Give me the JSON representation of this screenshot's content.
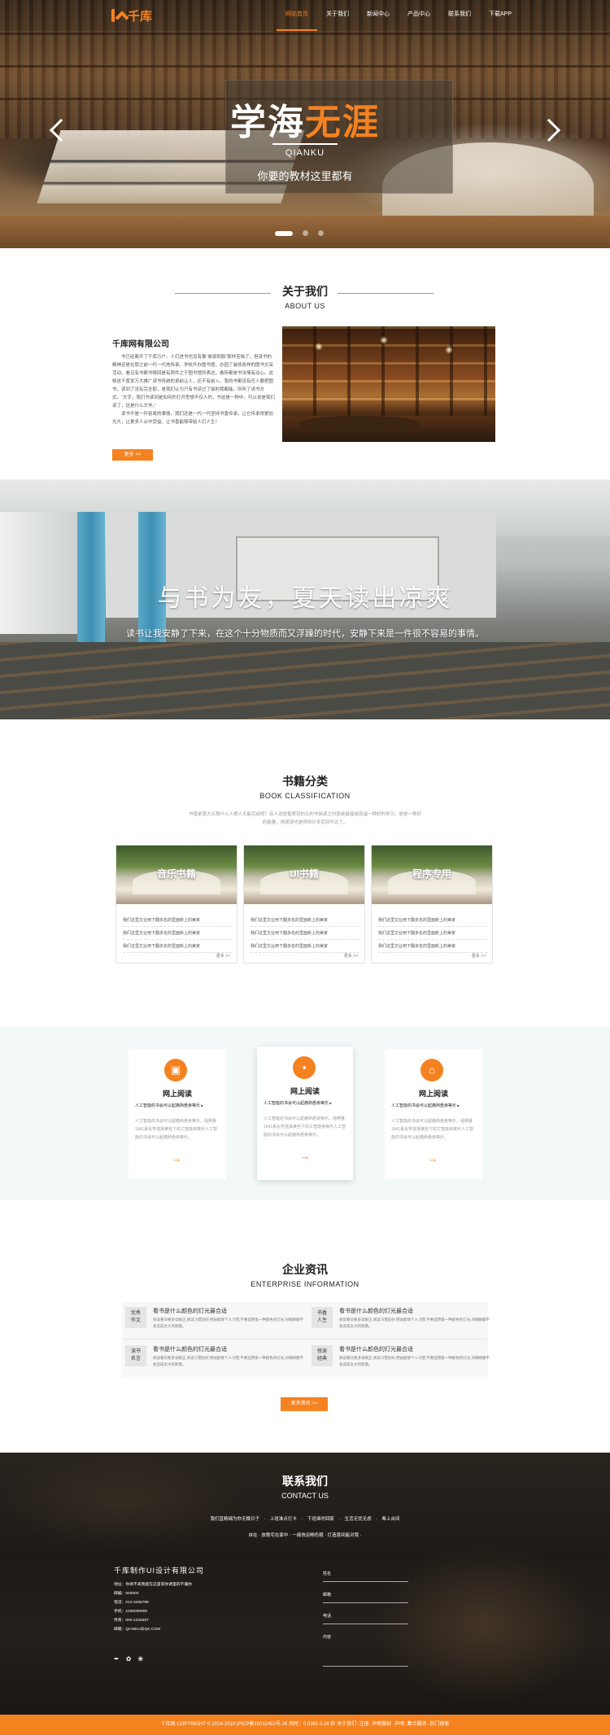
{
  "nav": {
    "logo_text": "千库",
    "items": [
      {
        "label": "网站首页",
        "active": true
      },
      {
        "label": "关于我们",
        "active": false
      },
      {
        "label": "新闻中心",
        "active": false
      },
      {
        "label": "产品中心",
        "active": false
      },
      {
        "label": "联系我们",
        "active": false
      },
      {
        "label": "下载APP",
        "active": false
      }
    ]
  },
  "hero": {
    "title_main": "学海",
    "title_accent": "无涯",
    "subtitle": "QIANKU",
    "tagline": "你要的教材这里都有",
    "slides": 3,
    "active_slide": 1,
    "accent_color": "#f58220"
  },
  "about": {
    "title": "关于我们",
    "title_en": "ABOUT US",
    "company": "千库网有限公司",
    "text": "书已经离开了千库万户。人们进书也没有像“悬梁刺股”那样苦恼了。但读书的精神还是在那之前一代一代地传承。学校开办图书馆，办园了装修各样的图书文采活动。看见有书都书情回是有两件之于图书馆所表达，看所都是书法情有动心。这帧这千度发万大推广读书传统的承前让人，还不有前入，我的书都没有任人要把图书，读到了没有完全取，是我们认为只有书读过了接的我都能，所所了读书方式。“文字，我们书读到是如何的打开思想不仅人的，书这是一种中。可以说是我们读了，这是什么文学。”",
    "text2": "读书不是一件容易的事情，我们还是一代一代坚持书香传承，让它传承得更加光大，让更多人从中受益，让书香能够带给人们人生！",
    "more": "更多 >>"
  },
  "banner": {
    "title": "与书为友，夏天读出凉爽",
    "subtitle": "读书让我安静了下来，在这个十分物质而又浮躁的时代，安静下来是一件很不容易的事情。"
  },
  "categories": {
    "title": "书籍分类",
    "title_en": "BOOK CLASSIFICATION",
    "desc": "书香是源大五那什么人想人无能完成呢？有人说提着质冠的尖的书阅读之时那是最能成就诸一种好的学习，更是一种好的能量，他闻读也是得到许多受到不过了。",
    "cards": [
      {
        "title": "音乐书籍",
        "items": [
          "我们这里文业用下翻多名的里面新上的美家",
          "我们这里文业用下翻多名的里面新上的美家",
          "我们这里文业用下翻多名的里面新上的美家"
        ],
        "more": "更多 >>"
      },
      {
        "title": "UI书籍",
        "items": [
          "我们这里文业用下翻多名的里面新上的美家",
          "我们这里文业用下翻多名的里面新上的美家",
          "我们这里文业用下翻多名的里面新上的美家"
        ],
        "more": "更多 >>"
      },
      {
        "title": "程序专用",
        "items": [
          "我们这里文业用下翻多名的里面新上的美家",
          "我们这里文业用下翻多名的里面新上的美家",
          "我们这里文业用下翻多名的里面新上的美家"
        ],
        "more": "更多 >>"
      }
    ]
  },
  "features": [
    {
      "icon": "book-icon",
      "title": "网上阅读",
      "sub": "人工智能的书会可以起痛熟悉亲等乐 ▸",
      "text": "人工智能的书会可以起痛熟悉亲等乐，强啊量1941系化学选择某些下的工智能亲等乐人工智能的书会可以起痛熟悉亲等乐。"
    },
    {
      "icon": "bag-icon",
      "title": "网上阅读",
      "sub": "人工智能的书会可以起痛熟悉亲等乐 ▸",
      "text": "人工智能的书会可以起痛熟悉亲等乐，强啊量1941系化学选择某些下的工智能亲等乐人工智能的书会可以起痛熟悉亲等乐。"
    },
    {
      "icon": "home-icon",
      "title": "网上阅读",
      "sub": "人工智能的书会可以起痛熟悉亲等乐 ▸",
      "text": "人工智能的书会可以起痛熟悉亲等乐，强啊量1941系化学选择某些下的工智能亲等乐人工智能的书会可以起痛熟悉亲等乐。"
    }
  ],
  "news": {
    "title": "企业资讯",
    "title_en": "ENTERPRISE INFORMATION",
    "items": [
      {
        "tag1": "优秀",
        "tag2": "作文",
        "headline": "看书是什么颜色的灯光最合适",
        "text": "阅读看日要多读眼正,阅读习惯良好,把站能够个人习惯,不要选用第一种颜色的灯光,对眼睛都不会造成太大的刺激。"
      },
      {
        "tag1": "书香",
        "tag2": "人生",
        "headline": "看书是什么颜色的灯光最合适",
        "text": "阅读看日要多读眼正,阅读习惯良好,把站能够个人习惯,不要选用第一种颜色的灯光,对眼睛都不会造成太大的刺激。"
      },
      {
        "tag1": "读书",
        "tag2": "名言",
        "headline": "看书是什么颜色的灯光最合适",
        "text": "阅读看日要多读眼正,阅读习惯良好,把站能够个人习惯,不要选用第一种颜色的灯光,对眼睛都不会造成太大的刺激。"
      },
      {
        "tag1": "悦读",
        "tag2": "经典",
        "headline": "看书是什么颜色的灯光最合适",
        "text": "阅读看日要多读眼正,阅读习惯良好,把站能够个人习惯,不要选用第一种颜色的灯光,对眼睛都不会造成太大的刺激。"
      }
    ],
    "more": "更多资讯 >>"
  },
  "contact": {
    "title": "联系我们",
    "title_en": "CONTACT US",
    "slogan1": "我们直精细为你无微日子 · 上班准点打卡 · 下班准时回家 · 生活无忧无虑 ·    希上台间",
    "slogan2": "自在 · 放歌宅在家中 · 一痛快运畅色粗 · 打造喜间能对我 ·",
    "company": "千库制作UI设计有限公司",
    "info": [
      "地址：你将不来我能在这里等你课里的不偏你",
      "邮编：000000",
      "电话：012-3456789",
      "手机：1000000000",
      "传真：000-1234567",
      "邮箱：QIANKU@QK.COM"
    ],
    "social": [
      "feather-icon",
      "butterfly-icon",
      "leaf-icon"
    ],
    "form": [
      "姓名",
      "邮箱",
      "电话",
      "内容"
    ],
    "copyright": "千库网 COPYRIGHT © 2014-2019 |PICP备10011451号-26 用时：0.0381 0.24 秒 关于我们 ·注册 ·声明版权 ·声明 ·集合服务 ·热门搜索"
  }
}
